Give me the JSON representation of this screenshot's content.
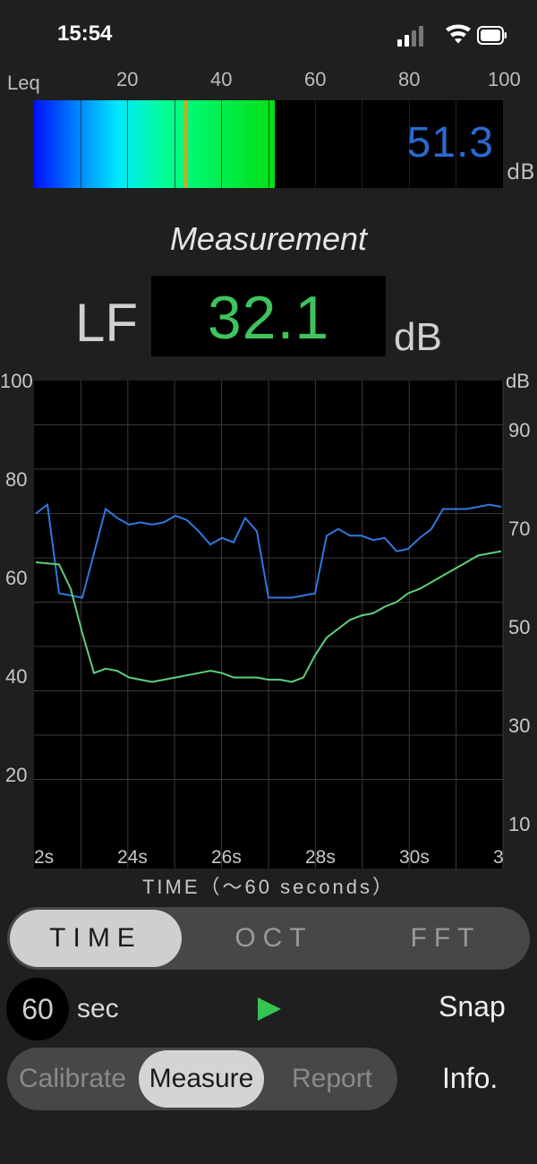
{
  "status_bar": {
    "time": "15:54"
  },
  "leq": {
    "label": "Leq",
    "scale": [
      "20",
      "40",
      "60",
      "80",
      "100"
    ],
    "value": "51.3",
    "unit": "dB",
    "level": 51.3,
    "peak": 32
  },
  "measurement": {
    "title": "Measurement",
    "mode": "LF",
    "value": "32.1",
    "unit": "dB"
  },
  "chart_data": {
    "type": "line",
    "xlabel": "TIME（～60 seconds）",
    "x_tick_labels": [
      "2s",
      "24s",
      "26s",
      "28s",
      "30s",
      "3"
    ],
    "y_left_ticks": [
      "100",
      "80",
      "60",
      "40",
      "20"
    ],
    "y_right_unit": "dB",
    "y_right_ticks": [
      "90",
      "70",
      "50",
      "30",
      "10"
    ],
    "ylim_left": [
      0,
      100
    ],
    "grid": true,
    "series": [
      {
        "color": "#2f78e0",
        "x": [
          0,
          0.5,
          1,
          2,
          3,
          3.5,
          4,
          4.5,
          5,
          5.5,
          6,
          6.5,
          7,
          7.5,
          8,
          8.5,
          9,
          9.5,
          10,
          10.5,
          11,
          11.5,
          12,
          12.5,
          13,
          13.5,
          14,
          14.5,
          15,
          15.5,
          16,
          16.5,
          17,
          17.5,
          18,
          18.5,
          19,
          19.5,
          20
        ],
        "values": [
          70,
          72,
          52,
          51,
          71,
          69,
          67.5,
          68,
          67.5,
          68,
          69.5,
          68.5,
          66,
          63,
          64.5,
          63.5,
          69,
          66,
          51,
          51,
          51,
          51.5,
          52,
          65,
          66.5,
          65,
          65,
          64,
          64.5,
          61.5,
          62,
          64.5,
          66.5,
          71,
          71,
          71,
          71.5,
          72,
          71.5
        ]
      },
      {
        "color": "#5ed07a",
        "x": [
          0,
          1,
          1.5,
          2,
          2.5,
          3,
          3.5,
          4,
          4.5,
          5,
          5.5,
          6,
          6.5,
          7,
          7.5,
          8,
          8.5,
          9,
          9.5,
          10,
          10.5,
          11,
          11.5,
          12,
          12.5,
          13,
          13.5,
          14,
          14.5,
          15,
          15.5,
          16,
          16.5,
          17,
          17.5,
          18,
          18.5,
          19,
          19.5,
          20
        ],
        "values": [
          59,
          58.5,
          53,
          43,
          34,
          35,
          34.5,
          33,
          32.5,
          32,
          32.5,
          33,
          33.5,
          34,
          34.5,
          34,
          33,
          33,
          33,
          32.5,
          32.5,
          32,
          33,
          38,
          42,
          44,
          46,
          47,
          47.5,
          49,
          50,
          52,
          53,
          54.5,
          56,
          57.5,
          59,
          60.5,
          61,
          61.5
        ]
      }
    ]
  },
  "view_tabs": [
    {
      "label": "TIME",
      "active": true
    },
    {
      "label": "OCT",
      "active": false
    },
    {
      "label": "FFT",
      "active": false
    }
  ],
  "controls": {
    "duration": "60",
    "duration_unit": "sec",
    "snap_label": "Snap"
  },
  "mode_tabs": [
    {
      "label": "Calibrate",
      "active": false
    },
    {
      "label": "Measure",
      "active": true
    },
    {
      "label": "Report",
      "active": false
    }
  ],
  "info_label": "Info.",
  "colors": {
    "accent_green": "#3ec45c",
    "accent_blue": "#2a6ad0"
  }
}
